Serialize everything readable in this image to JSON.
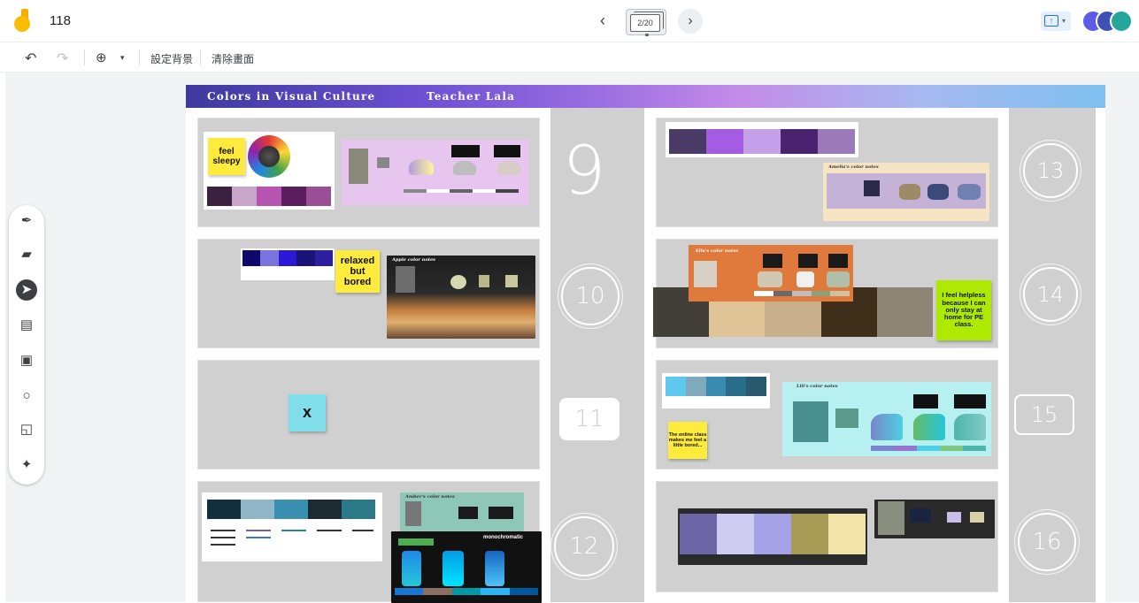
{
  "app": {
    "title": "118",
    "frame_indicator": "2/20",
    "toolbar": {
      "set_background": "設定背景",
      "clear_screen": "清除畫面"
    }
  },
  "board": {
    "banner_title": "Colors in Visual Culture",
    "banner_teacher": "Teacher Lala",
    "slot_numbers": [
      "9",
      "10",
      "11",
      "12",
      "13",
      "14",
      "15",
      "16"
    ],
    "stickies": {
      "s9": "feel sleepy",
      "s10": "relaxed but bored",
      "s11": "x",
      "s14": "I feel helpless because I can only stay at home for PE class.",
      "s15": "The online class makes me feel a little bored..."
    },
    "card_labels": {
      "c10": "Apple color notes",
      "c12": "Amber's color notes",
      "c12b": "monochromatic",
      "c13": "Amelia's color notes",
      "c14": "Ella's color notes",
      "c15": "Lili's color notes"
    }
  },
  "colors": {
    "banner_start": "#3d3a9e",
    "banner_end": "#7ec0ef",
    "panel_bg": "#d0d0d0",
    "sticky_yellow": "#ffeb3b",
    "sticky_lime": "#aeea00",
    "sticky_cyan": "#80deea"
  },
  "icons": {
    "undo": "undo-icon",
    "redo": "redo-icon",
    "zoom": "zoom-in-icon",
    "pen": "pen-icon",
    "eraser": "eraser-icon",
    "select": "select-arrow-icon",
    "sticky": "sticky-note-icon",
    "image": "image-icon",
    "shape": "circle-shape-icon",
    "textbox": "textbox-icon",
    "laser": "laser-icon"
  }
}
